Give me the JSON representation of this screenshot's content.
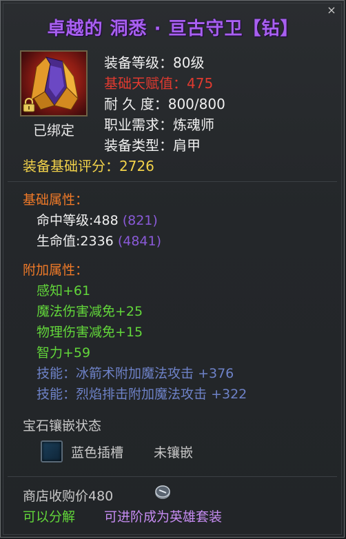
{
  "title": "卓越的 洞悉 · 亘古守卫【钻】",
  "close_glyph": "×",
  "item_icon": "shoulder-armor-icon",
  "bound_label": "已绑定",
  "stats": {
    "level_label": "装备等级：",
    "level_value": "80级",
    "talent_label": "基础天赋值：",
    "talent_value": "475",
    "durability_label": "耐 久 度：",
    "durability_value": "800/800",
    "class_label": "职业需求：",
    "class_value": "炼魂师",
    "type_label": "装备类型：",
    "type_value": "肩甲",
    "score_label": "装备基础评分：",
    "score_value": "2726"
  },
  "base_attrs": {
    "header": "基础属性：",
    "items": [
      {
        "label": "命中等级:488",
        "bonus": "(821)"
      },
      {
        "label": "生命值:2336",
        "bonus": "(4841)"
      }
    ]
  },
  "extra_attrs": {
    "header": "附加属性：",
    "green_items": [
      "感知+61",
      "魔法伤害减免+25",
      "物理伤害减免+15",
      "智力+59"
    ],
    "skills": [
      {
        "prefix": "技能：",
        "text": "冰箭术附加魔法攻击",
        "value": "+376"
      },
      {
        "prefix": "技能：",
        "text": "烈焰排击附加魔法攻击",
        "value": "+322"
      }
    ]
  },
  "gem": {
    "header": "宝石镶嵌状态",
    "slot_label": "蓝色插槽",
    "slot_status": "未镶嵌"
  },
  "footer": {
    "price_label": "商店收购价480",
    "decompose": "可以分解",
    "upgrade": "可进阶成为英雄套装"
  },
  "colors": {
    "title": "#a860f0",
    "talent": "#e03a30",
    "score": "#f2d24a",
    "header": "#f07a28",
    "green": "#62d63a",
    "skill": "#6e82c8",
    "bonus": "#8a5ad8"
  }
}
